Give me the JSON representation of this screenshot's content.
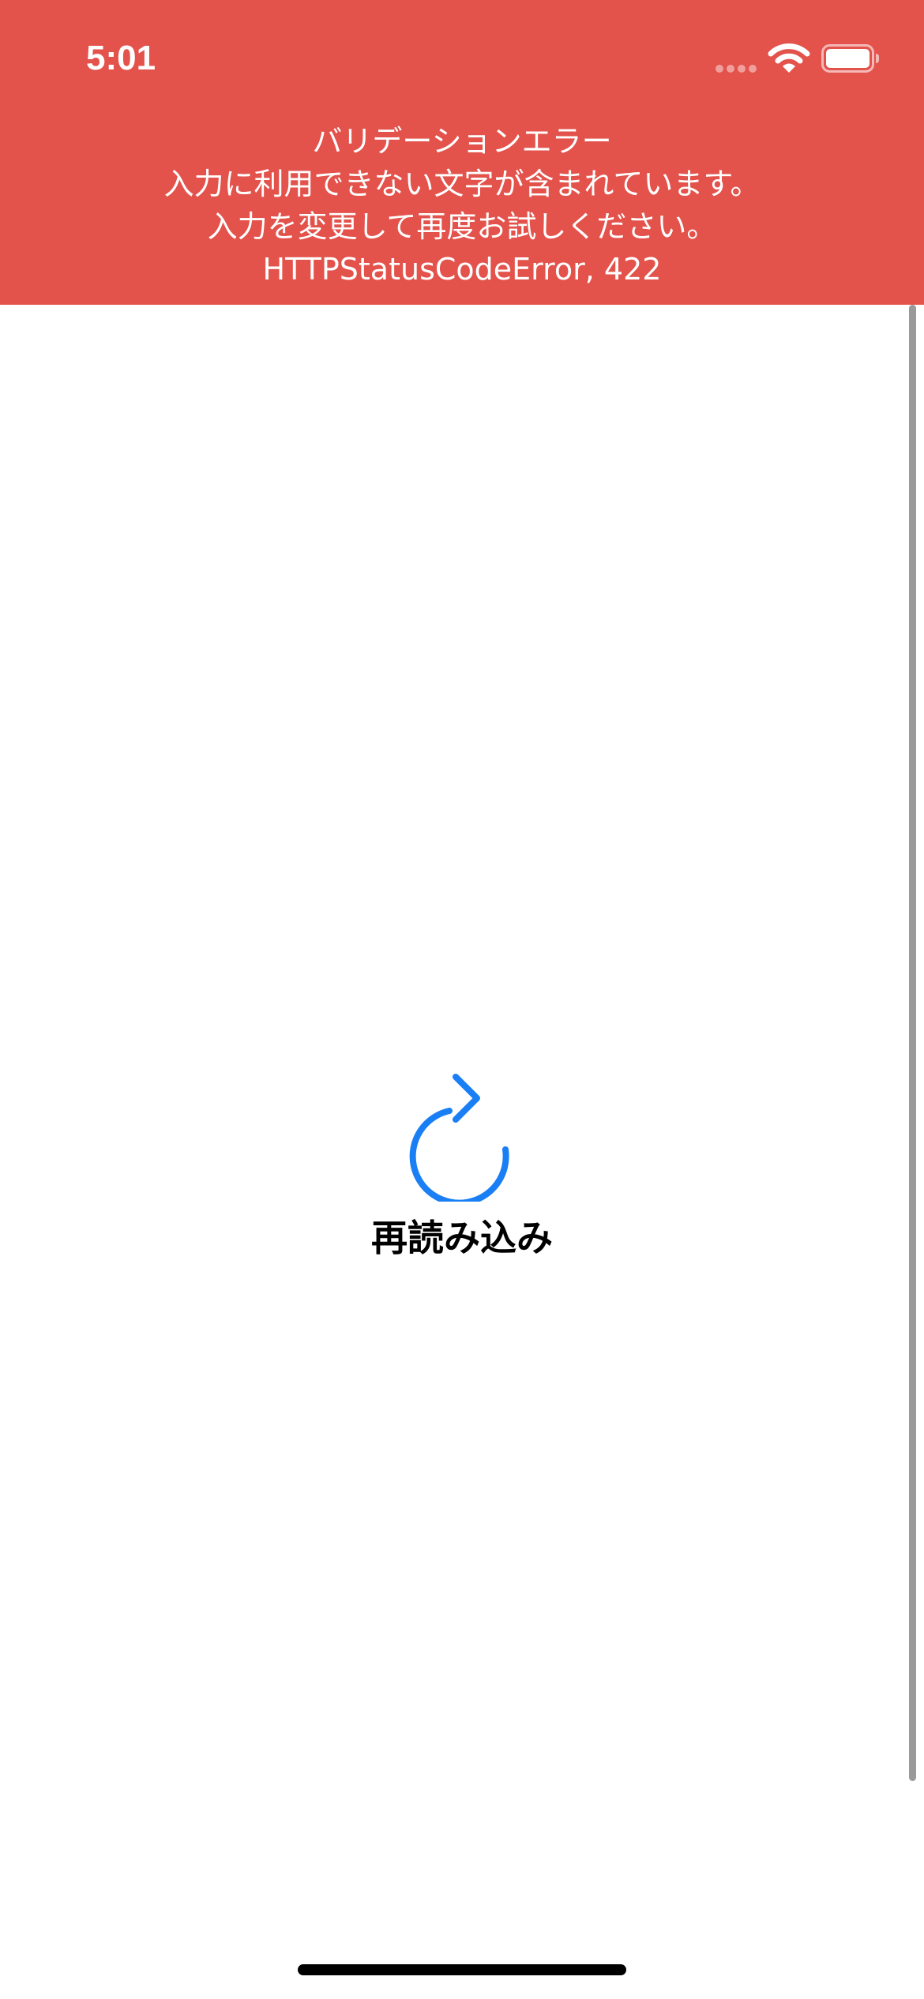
{
  "status_bar": {
    "time": "5:01"
  },
  "error_banner": {
    "background_color": "#e3524b",
    "lines": [
      "バリデーションエラー",
      "入力に利用できない文字が含まれています。",
      "入力を変更して再度お試しください。",
      "HTTPStatusCodeError, 422"
    ]
  },
  "reload": {
    "icon": "arrow-clockwise-icon",
    "label": "再読み込み",
    "accent_color": "#1a7ff5"
  }
}
